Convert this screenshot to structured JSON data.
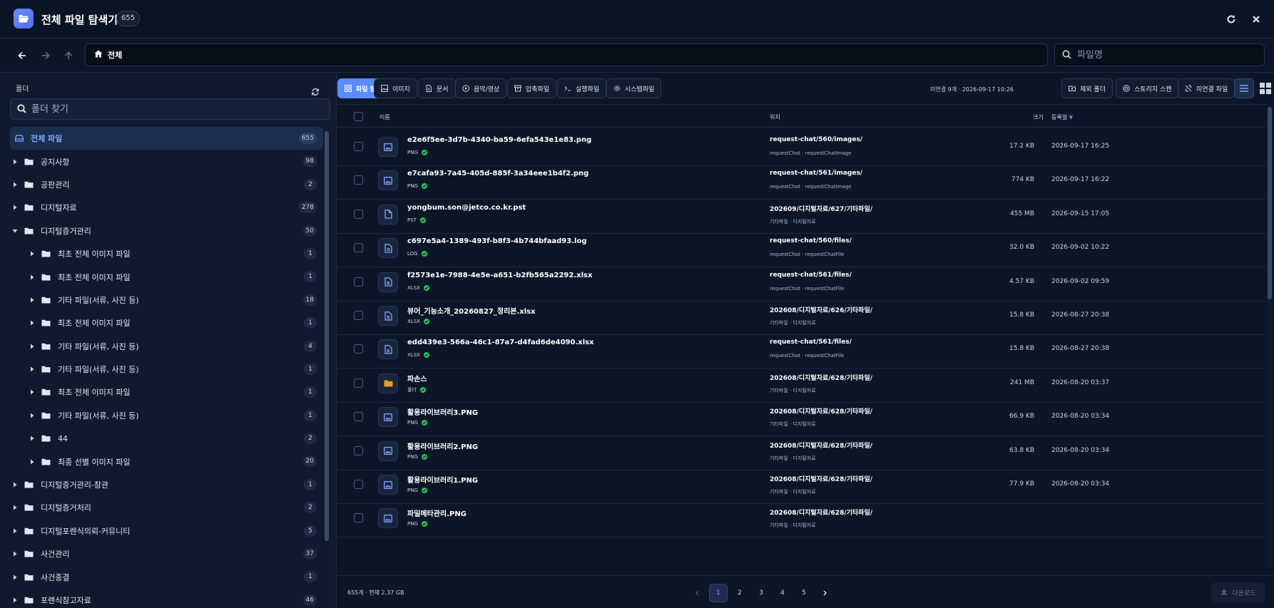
{
  "app": {
    "title": "전체 파일 탐색기",
    "count": "655"
  },
  "nav": {
    "breadcrumb": "전체",
    "search_placeholder": "파일명"
  },
  "sidebar": {
    "heading": "폴더",
    "search_placeholder": "폴더 찾기",
    "items": [
      {
        "label": "전체 파일",
        "count": "655",
        "level": 0,
        "expanded": false,
        "active": true
      },
      {
        "label": "공지사항",
        "count": "98",
        "level": 0,
        "expanded": false
      },
      {
        "label": "공판관리",
        "count": "2",
        "level": 0,
        "expanded": false
      },
      {
        "label": "디지털자료",
        "count": "278",
        "level": 0,
        "expanded": false
      },
      {
        "label": "디지털증거관리",
        "count": "50",
        "level": 0,
        "expanded": true
      },
      {
        "label": "최초 전체 이미지 파일",
        "count": "1",
        "level": 1,
        "expanded": false
      },
      {
        "label": "최초 전체 이미지 파일",
        "count": "1",
        "level": 1,
        "expanded": false
      },
      {
        "label": "기타 파일(서류, 사진 등)",
        "count": "18",
        "level": 1,
        "expanded": false
      },
      {
        "label": "최초 전체 이미지 파일",
        "count": "1",
        "level": 1,
        "expanded": false
      },
      {
        "label": "기타 파일(서류, 사진 등)",
        "count": "4",
        "level": 1,
        "expanded": false
      },
      {
        "label": "기타 파일(서류, 사진 등)",
        "count": "1",
        "level": 1,
        "expanded": false
      },
      {
        "label": "최초 전체 이미지 파일",
        "count": "1",
        "level": 1,
        "expanded": false
      },
      {
        "label": "기타 파일(서류, 사진 등)",
        "count": "1",
        "level": 1,
        "expanded": false
      },
      {
        "label": "44",
        "count": "2",
        "level": 1,
        "expanded": false
      },
      {
        "label": "최종 선별 이미지 파일",
        "count": "20",
        "level": 1,
        "expanded": false
      },
      {
        "label": "디지털증거관리-참관",
        "count": "1",
        "level": 0,
        "expanded": false
      },
      {
        "label": "디지털증거처리",
        "count": "2",
        "level": 0,
        "expanded": false
      },
      {
        "label": "디지털포렌식의뢰-커뮤니티",
        "count": "5",
        "level": 0,
        "expanded": false
      },
      {
        "label": "사건관리",
        "count": "37",
        "level": 0,
        "expanded": false
      },
      {
        "label": "사건종결",
        "count": "1",
        "level": 0,
        "expanded": false
      },
      {
        "label": "포렌식참고자료",
        "count": "46",
        "level": 0,
        "expanded": false
      }
    ]
  },
  "filters": [
    {
      "label": "파일 탐색기",
      "icon": "grid-icon",
      "active": true
    },
    {
      "label": "이미지",
      "icon": "image-icon"
    },
    {
      "label": "문서",
      "icon": "document-icon"
    },
    {
      "label": "음악/영상",
      "icon": "play-icon"
    },
    {
      "label": "압축파일",
      "icon": "archive-icon"
    },
    {
      "label": "실행파일",
      "icon": "terminal-icon"
    },
    {
      "label": "시스템파일",
      "icon": "gear-icon"
    }
  ],
  "status": {
    "text": "미연결 9개 · 2026-09-17 10:26"
  },
  "actions": [
    {
      "label": "제외 폴더",
      "icon": "folder-x-icon"
    },
    {
      "label": "스토리지 스캔",
      "icon": "scan-icon"
    },
    {
      "label": "미연결 파일",
      "icon": "unlink-icon"
    }
  ],
  "table": {
    "headers": {
      "name": "이름",
      "location": "위치",
      "size": "크기",
      "date": "등록일"
    },
    "rows": [
      {
        "name": "e2e6f5ee-3d7b-4340-ba59-6efa543e1e83.png",
        "type": "PNG",
        "icon": "image-icon",
        "location": "request-chat/560/images/",
        "sub": "requestChat · requestChatImage",
        "size": "17.2 KB",
        "date": "2026-09-17 16:25"
      },
      {
        "name": "e7cafa93-7a45-405d-885f-3a34eee1b4f2.png",
        "type": "PNG",
        "icon": "image-icon",
        "location": "request-chat/561/images/",
        "sub": "requestChat · requestChatImage",
        "size": "774 KB",
        "date": "2026-09-17 16:22"
      },
      {
        "name": "yongbum.son@jetco.co.kr.pst",
        "type": "PST",
        "icon": "file-icon",
        "location": "202609/디지털자료/627/기타파일/",
        "sub": "기타파일 · 디지털자료",
        "size": "455 MB",
        "date": "2026-09-15 17:05"
      },
      {
        "name": "c697e5a4-1389-493f-b8f3-4b744bfaad93.log",
        "type": "LOG",
        "icon": "doc-text-icon",
        "location": "request-chat/560/files/",
        "sub": "requestChat · requestChatFile",
        "size": "32.0 KB",
        "date": "2026-09-02 10:22"
      },
      {
        "name": "f2573e1e-7988-4e5e-a651-b2fb565a2292.xlsx",
        "type": "XLSX",
        "icon": "spreadsheet-icon",
        "location": "request-chat/561/files/",
        "sub": "requestChat · requestChatFile",
        "size": "4.57 KB",
        "date": "2026-09-02 09:59"
      },
      {
        "name": "뷰어_기능소개_20260827_정리본.xlsx",
        "type": "XLSX",
        "icon": "spreadsheet-icon",
        "location": "202608/디지털자료/626/기타파일/",
        "sub": "기타파일 · 디지털자료",
        "size": "15.8 KB",
        "date": "2026-08-27 20:38"
      },
      {
        "name": "edd439e3-566a-46c1-87a7-d4fad6de4090.xlsx",
        "type": "XLSX",
        "icon": "spreadsheet-icon",
        "location": "request-chat/561/files/",
        "sub": "requestChat · requestChatFile",
        "size": "15.8 KB",
        "date": "2026-08-27 20:38"
      },
      {
        "name": "파손스",
        "type": "폴더",
        "icon": "folder-icon",
        "location": "202608/디지털자료/628/기타파일/",
        "sub": "기타파일 · 디지털자료",
        "size": "241 MB",
        "date": "2026-08-20 03:37"
      },
      {
        "name": "활용라이브러리3.PNG",
        "type": "PNG",
        "icon": "image-icon",
        "location": "202608/디지털자료/628/기타파일/",
        "sub": "기타파일 · 디지털자료",
        "size": "66.9 KB",
        "date": "2026-08-20 03:34"
      },
      {
        "name": "활용라이브러리2.PNG",
        "type": "PNG",
        "icon": "image-icon",
        "location": "202608/디지털자료/628/기타파일/",
        "sub": "기타파일 · 디지털자료",
        "size": "63.8 KB",
        "date": "2026-08-20 03:34"
      },
      {
        "name": "활용라이브러리1.PNG",
        "type": "PNG",
        "icon": "image-icon",
        "location": "202608/디지털자료/628/기타파일/",
        "sub": "기타파일 · 디지털자료",
        "size": "77.9 KB",
        "date": "2026-08-20 03:34"
      },
      {
        "name": "파일메타관리.PNG",
        "type": "PNG",
        "icon": "image-icon",
        "location": "202608/디지털자료/628/기타파일/",
        "sub": "기타파일 · 디지털자료",
        "size": "",
        "date": ""
      }
    ]
  },
  "footer": {
    "summary": "655개 · 현재 2.37 GB",
    "pages": [
      "1",
      "2",
      "3",
      "4",
      "5"
    ],
    "current_page": "1",
    "download": "다운로드"
  },
  "colors": {
    "accent": "#5b8cff",
    "background": "#0d1628",
    "success": "#22c55e",
    "folder": "#e0a21a"
  }
}
